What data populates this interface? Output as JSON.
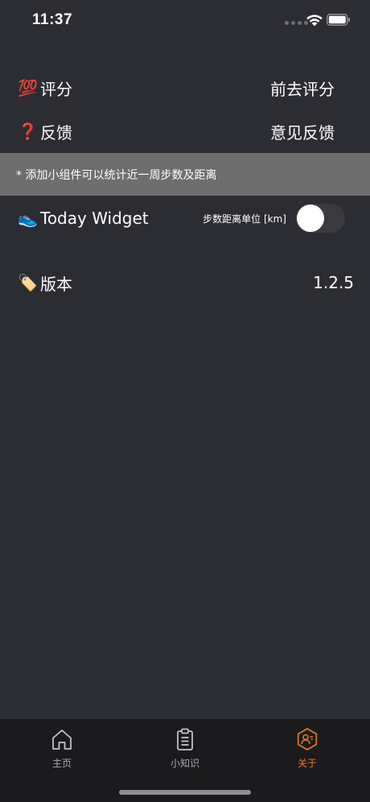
{
  "status_bar": {
    "time": "11:37"
  },
  "rating": {
    "icon": "hundred-points-icon",
    "emoji": "💯",
    "label": "评分",
    "action": "前去评分"
  },
  "feedback": {
    "icon": "question-mark-icon",
    "emoji": "❓",
    "label": "反馈",
    "action": "意见反馈"
  },
  "info_banner": {
    "text": "* 添加小组件可以统计近一周步数及距离"
  },
  "widget": {
    "icon": "sneaker-icon",
    "emoji": "👟",
    "label": "Today Widget",
    "setting_label": "步数距离单位 [km]",
    "toggle_on": false
  },
  "version": {
    "icon": "tag-icon",
    "emoji": "🏷️",
    "label": "版本",
    "value": "1.2.5"
  },
  "tab_bar": {
    "tabs": [
      {
        "label": "主页",
        "icon": "home-icon",
        "active": false
      },
      {
        "label": "小知识",
        "icon": "clipboard-icon",
        "active": false
      },
      {
        "label": "关于",
        "icon": "about-user-icon",
        "active": true
      }
    ]
  },
  "colors": {
    "background": "#2c2d33",
    "banner": "#6e6e6f",
    "tab_bar": "#1b1b1d",
    "accent": "#e8782b",
    "inactive_tab": "#a8a9ad"
  }
}
